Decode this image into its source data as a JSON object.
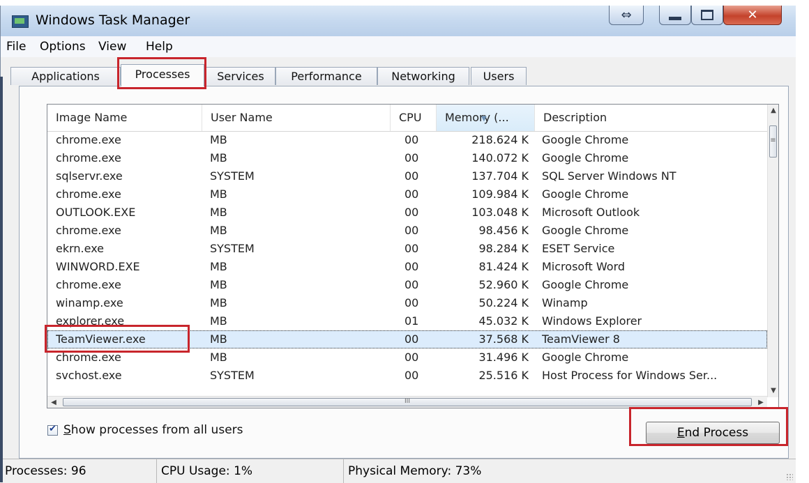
{
  "window": {
    "title": "Windows Task Manager"
  },
  "menu": [
    "File",
    "Options",
    "View",
    "Help"
  ],
  "tabs": [
    "Applications",
    "Processes",
    "Services",
    "Performance",
    "Networking",
    "Users"
  ],
  "active_tab": "Processes",
  "columns": [
    "Image Name",
    "User Name",
    "CPU",
    "Memory (...",
    "Description"
  ],
  "processes": [
    {
      "name": "chrome.exe",
      "user": "MB",
      "cpu": "00",
      "memory": "218.624 K",
      "description": "Google Chrome"
    },
    {
      "name": "chrome.exe",
      "user": "MB",
      "cpu": "00",
      "memory": "140.072 K",
      "description": "Google Chrome"
    },
    {
      "name": "sqlservr.exe",
      "user": "SYSTEM",
      "cpu": "00",
      "memory": "137.704 K",
      "description": "SQL Server Windows NT"
    },
    {
      "name": "chrome.exe",
      "user": "MB",
      "cpu": "00",
      "memory": "109.984 K",
      "description": "Google Chrome"
    },
    {
      "name": "OUTLOOK.EXE",
      "user": "MB",
      "cpu": "00",
      "memory": "103.048 K",
      "description": "Microsoft Outlook"
    },
    {
      "name": "chrome.exe",
      "user": "MB",
      "cpu": "00",
      "memory": "98.456 K",
      "description": "Google Chrome"
    },
    {
      "name": "ekrn.exe",
      "user": "SYSTEM",
      "cpu": "00",
      "memory": "98.284 K",
      "description": "ESET Service"
    },
    {
      "name": "WINWORD.EXE",
      "user": "MB",
      "cpu": "00",
      "memory": "81.424 K",
      "description": "Microsoft Word"
    },
    {
      "name": "chrome.exe",
      "user": "MB",
      "cpu": "00",
      "memory": "52.960 K",
      "description": "Google Chrome"
    },
    {
      "name": "winamp.exe",
      "user": "MB",
      "cpu": "00",
      "memory": "50.224 K",
      "description": "Winamp"
    },
    {
      "name": "explorer.exe",
      "user": "MB",
      "cpu": "01",
      "memory": "45.032 K",
      "description": "Windows Explorer"
    },
    {
      "name": "TeamViewer.exe",
      "user": "MB",
      "cpu": "00",
      "memory": "37.568 K",
      "description": "TeamViewer 8",
      "selected": true
    },
    {
      "name": "chrome.exe",
      "user": "MB",
      "cpu": "00",
      "memory": "31.496 K",
      "description": "Google Chrome"
    },
    {
      "name": "svchost.exe",
      "user": "SYSTEM",
      "cpu": "00",
      "memory": "25.516 K",
      "description": "Host Process for Windows Ser..."
    }
  ],
  "show_all_users": {
    "accel": "S",
    "rest": "how processes from all users",
    "checked": true
  },
  "end_process": {
    "accel": "E",
    "rest": "nd Process"
  },
  "status": {
    "processes": "Processes: 96",
    "cpu": "CPU Usage: 1%",
    "memory": "Physical Memory: 73%"
  },
  "scroll_glyph": "III",
  "colors": {
    "highlight": "#c8252c",
    "selection": "#dcecfc",
    "titlebar": "#c6d9ef"
  }
}
